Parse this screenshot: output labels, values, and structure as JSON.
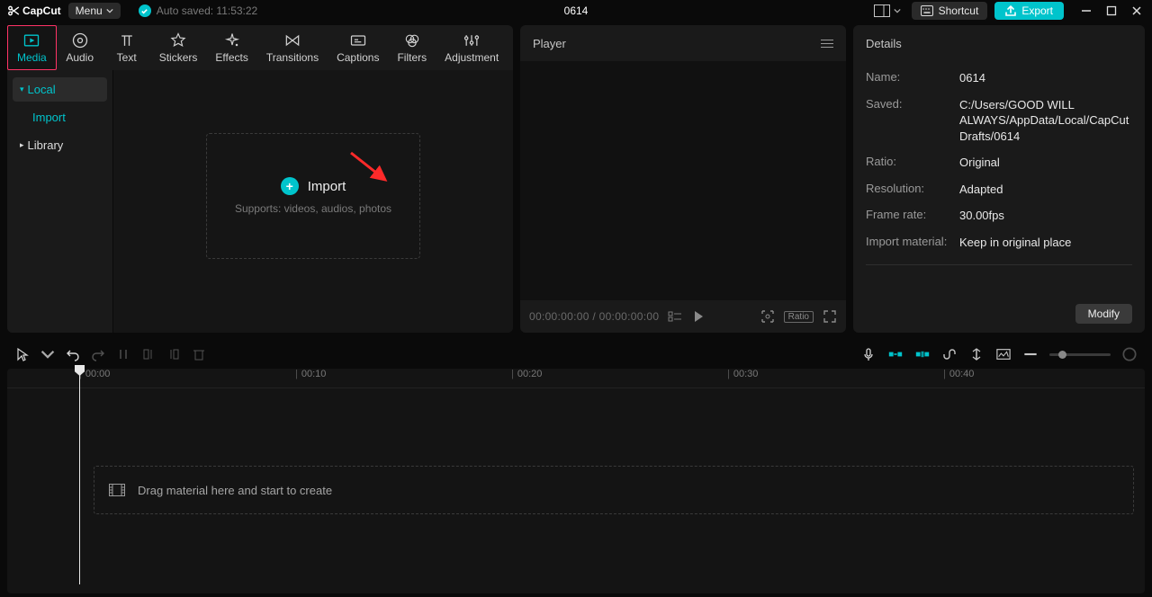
{
  "app": {
    "name": "CapCut"
  },
  "menu": {
    "label": "Menu"
  },
  "autosave": {
    "text": "Auto saved: 11:53:22"
  },
  "project": {
    "title": "0614"
  },
  "buttons": {
    "shortcut": "Shortcut",
    "export": "Export",
    "modify": "Modify"
  },
  "tabs": [
    {
      "id": "media",
      "label": "Media"
    },
    {
      "id": "audio",
      "label": "Audio"
    },
    {
      "id": "text",
      "label": "Text"
    },
    {
      "id": "stickers",
      "label": "Stickers"
    },
    {
      "id": "effects",
      "label": "Effects"
    },
    {
      "id": "transitions",
      "label": "Transitions"
    },
    {
      "id": "captions",
      "label": "Captions"
    },
    {
      "id": "filters",
      "label": "Filters"
    },
    {
      "id": "adjustment",
      "label": "Adjustment"
    }
  ],
  "sidebar": {
    "local": "Local",
    "import": "Import",
    "library": "Library"
  },
  "import_box": {
    "label": "Import",
    "sub": "Supports: videos, audios, photos"
  },
  "player": {
    "title": "Player",
    "time_current": "00:00:00:00",
    "time_sep": " / ",
    "time_total": "00:00:00:00",
    "ratio_btn": "Ratio"
  },
  "details": {
    "title": "Details",
    "rows": {
      "name_k": "Name:",
      "name_v": "0614",
      "saved_k": "Saved:",
      "saved_v": "C:/Users/GOOD WILL ALWAYS/AppData/Local/CapCut Drafts/0614",
      "ratio_k": "Ratio:",
      "ratio_v": "Original",
      "resolution_k": "Resolution:",
      "resolution_v": "Adapted",
      "framerate_k": "Frame rate:",
      "framerate_v": "30.00fps",
      "importmat_k": "Import material:",
      "importmat_v": "Keep in original place"
    }
  },
  "timeline": {
    "marks": [
      "00:00",
      "00:10",
      "00:20",
      "00:30",
      "00:40"
    ],
    "drop_text": "Drag material here and start to create"
  }
}
